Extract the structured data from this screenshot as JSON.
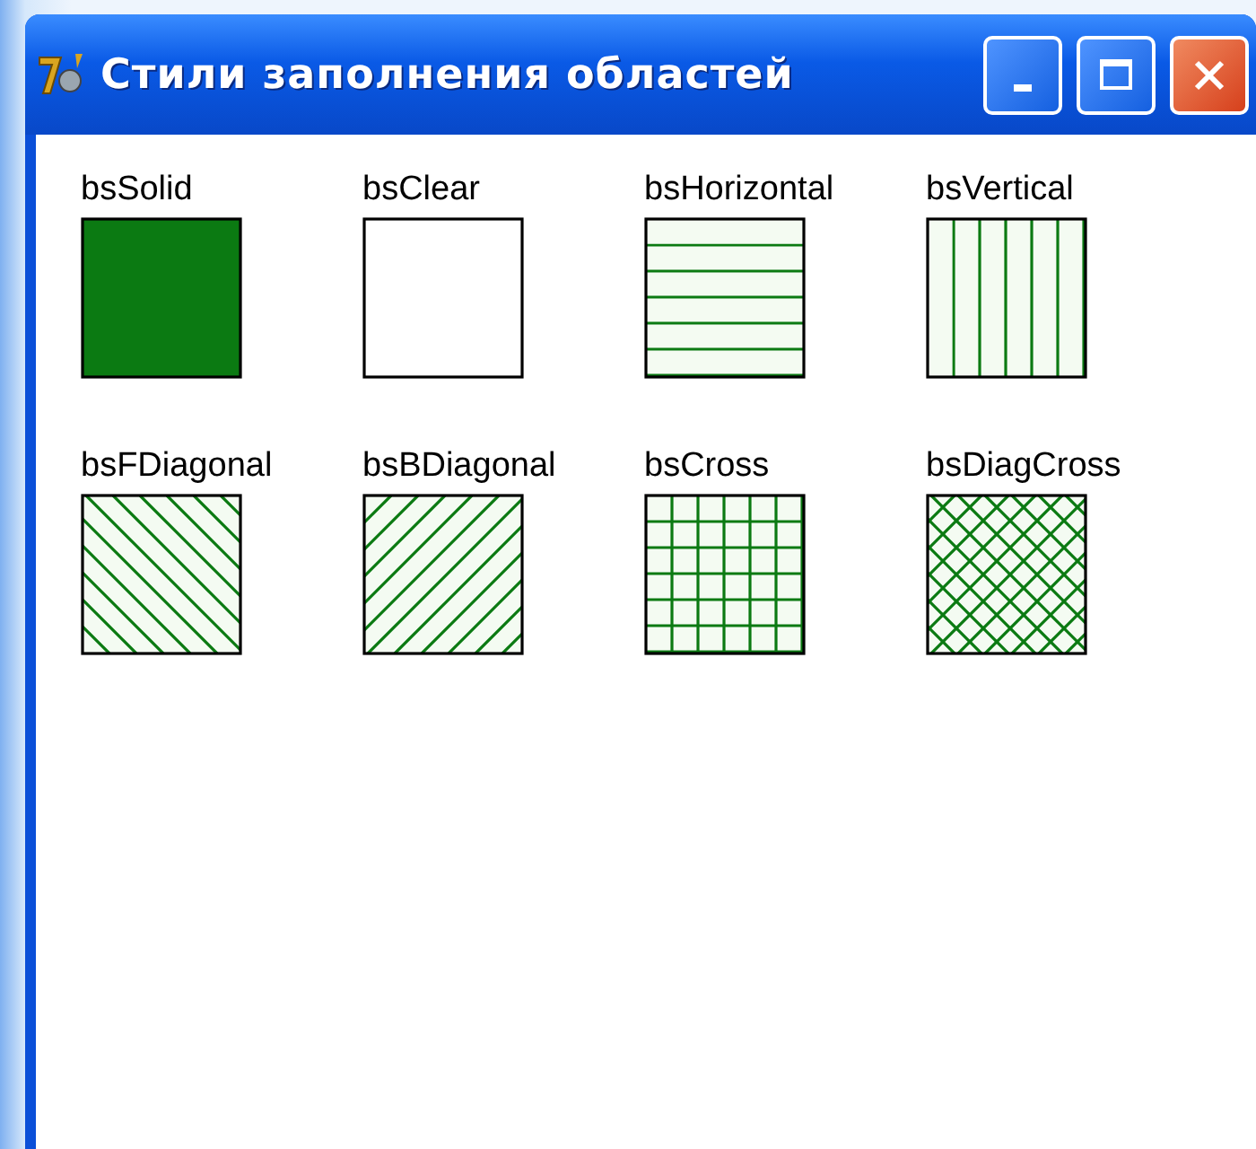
{
  "window": {
    "title": "Стили заполнения областей"
  },
  "swatches": [
    {
      "label": "bsSolid",
      "kind": "solid"
    },
    {
      "label": "bsClear",
      "kind": "clear"
    },
    {
      "label": "bsHorizontal",
      "kind": "horizontal"
    },
    {
      "label": "bsVertical",
      "kind": "vertical"
    },
    {
      "label": "bsFDiagonal",
      "kind": "fdiagonal"
    },
    {
      "label": "bsBDiagonal",
      "kind": "bdiagonal"
    },
    {
      "label": "bsCross",
      "kind": "cross"
    },
    {
      "label": "bsDiagCross",
      "kind": "diagcross"
    }
  ]
}
